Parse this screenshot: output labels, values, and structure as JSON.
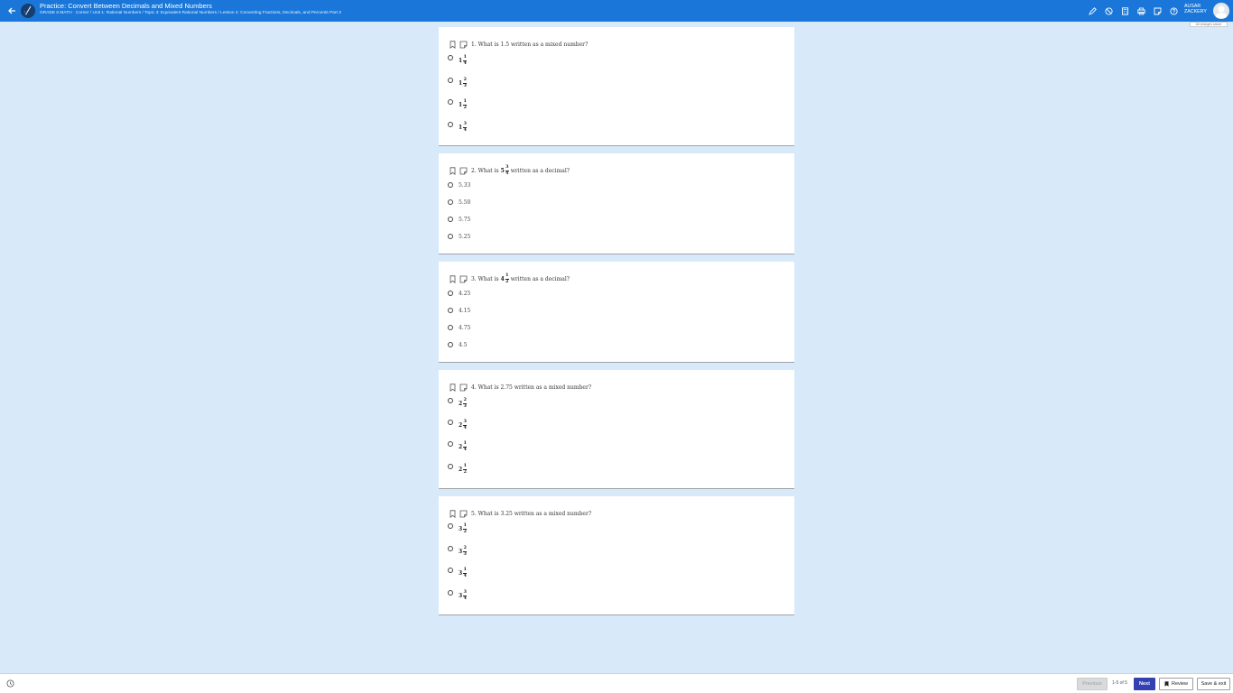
{
  "header": {
    "title": "Practice: Convert Between Decimals and Mixed Numbers",
    "breadcrumb": "GRADE 6 MATH · Corner / Unit 1: Rational Numbers / Topic 3: Equivalent Rational Numbers / Lesson 4: Converting Fractions, Decimals, and Percents Part 3",
    "user_line1": "AUSAR",
    "user_line2": "ZACKERY",
    "saved_note": "All changes saved",
    "icons": [
      "pencil-icon",
      "no-symbol-icon",
      "calculator-icon",
      "printer-icon",
      "notepad-icon",
      "help-icon"
    ]
  },
  "questions": [
    {
      "number": "1.",
      "prompt": "What is 1.5 written as a mixed number?",
      "options": [
        {
          "whole": "1",
          "num": "1",
          "den": "4"
        },
        {
          "whole": "1",
          "num": "2",
          "den": "3"
        },
        {
          "whole": "1",
          "num": "1",
          "den": "2"
        },
        {
          "whole": "1",
          "num": "3",
          "den": "4"
        }
      ]
    },
    {
      "number": "2.",
      "prompt_before": "What is",
      "prompt_whole": "5",
      "prompt_num": "3",
      "prompt_den": "4",
      "prompt_after": "written as a decimal?",
      "options": [
        "5.33",
        "5.50",
        "5.75",
        "5.25"
      ]
    },
    {
      "number": "3.",
      "prompt_before": "What is",
      "prompt_whole": "4",
      "prompt_num": "1",
      "prompt_den": "2",
      "prompt_after": "written as a decimal?",
      "options": [
        "4.25",
        "4.15",
        "4.75",
        "4.5"
      ]
    },
    {
      "number": "4.",
      "prompt": "What is 2.75 written as a mixed number?",
      "options": [
        {
          "whole": "2",
          "num": "2",
          "den": "3"
        },
        {
          "whole": "2",
          "num": "3",
          "den": "4"
        },
        {
          "whole": "2",
          "num": "1",
          "den": "4"
        },
        {
          "whole": "2",
          "num": "1",
          "den": "2"
        }
      ]
    },
    {
      "number": "5.",
      "prompt": "What is 3.25 written as a mixed number?",
      "options": [
        {
          "whole": "3",
          "num": "1",
          "den": "2"
        },
        {
          "whole": "3",
          "num": "2",
          "den": "3"
        },
        {
          "whole": "3",
          "num": "1",
          "den": "4"
        },
        {
          "whole": "3",
          "num": "3",
          "den": "4"
        }
      ]
    }
  ],
  "footer": {
    "previous_label": "Previous",
    "page_count": "1-5 of 5",
    "next_label": "Next",
    "review_label": "Review",
    "save_exit_label": "Save & exit"
  }
}
